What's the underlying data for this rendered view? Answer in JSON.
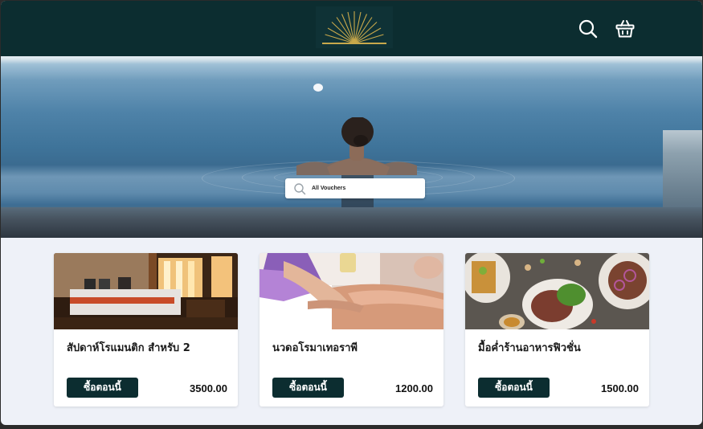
{
  "header": {
    "logo_icon": "sunburst-logo",
    "search_icon": "search-icon",
    "cart_icon": "basket-icon",
    "background_color": "#0c2d30",
    "accent_color": "#c8a84b"
  },
  "hero": {
    "image": "woman-in-infinity-pool-ocean",
    "search": {
      "label": "All Vouchers",
      "icon": "search-icon"
    }
  },
  "products": [
    {
      "title": "สัปดาห์โรแมนติก สำหรับ 2",
      "button_label": "ซื้อตอนนี้",
      "price": "3500.00",
      "image": "hotel-bedroom"
    },
    {
      "title": "นวดอโรมาเทอราพี",
      "button_label": "ซื้อตอนนี้",
      "price": "1200.00",
      "image": "aromatherapy-massage"
    },
    {
      "title": "มื้อค่ำร้านอาหารฟิวชั่น",
      "button_label": "ซื้อตอนนี้",
      "price": "1500.00",
      "image": "fusion-dinner-dishes"
    }
  ]
}
